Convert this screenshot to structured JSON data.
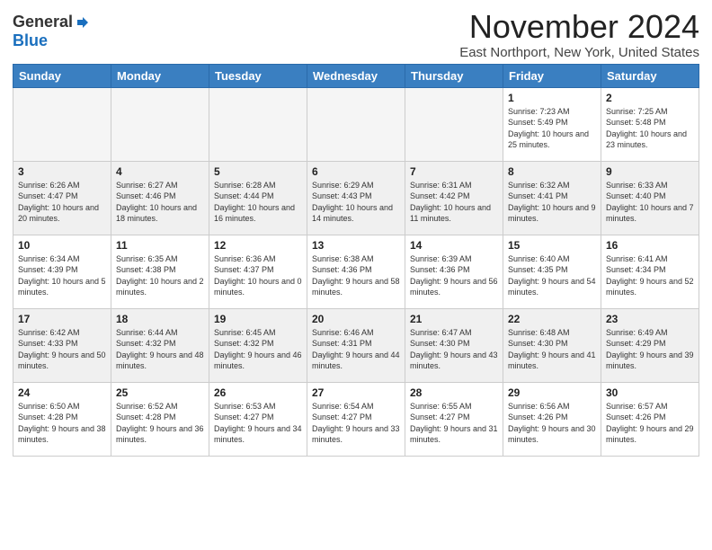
{
  "header": {
    "logo_line1": "General",
    "logo_line2": "Blue",
    "month": "November 2024",
    "location": "East Northport, New York, United States"
  },
  "weekdays": [
    "Sunday",
    "Monday",
    "Tuesday",
    "Wednesday",
    "Thursday",
    "Friday",
    "Saturday"
  ],
  "weeks": [
    [
      {
        "day": "",
        "info": "",
        "empty": true
      },
      {
        "day": "",
        "info": "",
        "empty": true
      },
      {
        "day": "",
        "info": "",
        "empty": true
      },
      {
        "day": "",
        "info": "",
        "empty": true
      },
      {
        "day": "",
        "info": "",
        "empty": true
      },
      {
        "day": "1",
        "info": "Sunrise: 7:23 AM\nSunset: 5:49 PM\nDaylight: 10 hours and 25 minutes."
      },
      {
        "day": "2",
        "info": "Sunrise: 7:25 AM\nSunset: 5:48 PM\nDaylight: 10 hours and 23 minutes."
      }
    ],
    [
      {
        "day": "3",
        "info": "Sunrise: 6:26 AM\nSunset: 4:47 PM\nDaylight: 10 hours and 20 minutes."
      },
      {
        "day": "4",
        "info": "Sunrise: 6:27 AM\nSunset: 4:46 PM\nDaylight: 10 hours and 18 minutes."
      },
      {
        "day": "5",
        "info": "Sunrise: 6:28 AM\nSunset: 4:44 PM\nDaylight: 10 hours and 16 minutes."
      },
      {
        "day": "6",
        "info": "Sunrise: 6:29 AM\nSunset: 4:43 PM\nDaylight: 10 hours and 14 minutes."
      },
      {
        "day": "7",
        "info": "Sunrise: 6:31 AM\nSunset: 4:42 PM\nDaylight: 10 hours and 11 minutes."
      },
      {
        "day": "8",
        "info": "Sunrise: 6:32 AM\nSunset: 4:41 PM\nDaylight: 10 hours and 9 minutes."
      },
      {
        "day": "9",
        "info": "Sunrise: 6:33 AM\nSunset: 4:40 PM\nDaylight: 10 hours and 7 minutes."
      }
    ],
    [
      {
        "day": "10",
        "info": "Sunrise: 6:34 AM\nSunset: 4:39 PM\nDaylight: 10 hours and 5 minutes."
      },
      {
        "day": "11",
        "info": "Sunrise: 6:35 AM\nSunset: 4:38 PM\nDaylight: 10 hours and 2 minutes."
      },
      {
        "day": "12",
        "info": "Sunrise: 6:36 AM\nSunset: 4:37 PM\nDaylight: 10 hours and 0 minutes."
      },
      {
        "day": "13",
        "info": "Sunrise: 6:38 AM\nSunset: 4:36 PM\nDaylight: 9 hours and 58 minutes."
      },
      {
        "day": "14",
        "info": "Sunrise: 6:39 AM\nSunset: 4:36 PM\nDaylight: 9 hours and 56 minutes."
      },
      {
        "day": "15",
        "info": "Sunrise: 6:40 AM\nSunset: 4:35 PM\nDaylight: 9 hours and 54 minutes."
      },
      {
        "day": "16",
        "info": "Sunrise: 6:41 AM\nSunset: 4:34 PM\nDaylight: 9 hours and 52 minutes."
      }
    ],
    [
      {
        "day": "17",
        "info": "Sunrise: 6:42 AM\nSunset: 4:33 PM\nDaylight: 9 hours and 50 minutes."
      },
      {
        "day": "18",
        "info": "Sunrise: 6:44 AM\nSunset: 4:32 PM\nDaylight: 9 hours and 48 minutes."
      },
      {
        "day": "19",
        "info": "Sunrise: 6:45 AM\nSunset: 4:32 PM\nDaylight: 9 hours and 46 minutes."
      },
      {
        "day": "20",
        "info": "Sunrise: 6:46 AM\nSunset: 4:31 PM\nDaylight: 9 hours and 44 minutes."
      },
      {
        "day": "21",
        "info": "Sunrise: 6:47 AM\nSunset: 4:30 PM\nDaylight: 9 hours and 43 minutes."
      },
      {
        "day": "22",
        "info": "Sunrise: 6:48 AM\nSunset: 4:30 PM\nDaylight: 9 hours and 41 minutes."
      },
      {
        "day": "23",
        "info": "Sunrise: 6:49 AM\nSunset: 4:29 PM\nDaylight: 9 hours and 39 minutes."
      }
    ],
    [
      {
        "day": "24",
        "info": "Sunrise: 6:50 AM\nSunset: 4:28 PM\nDaylight: 9 hours and 38 minutes."
      },
      {
        "day": "25",
        "info": "Sunrise: 6:52 AM\nSunset: 4:28 PM\nDaylight: 9 hours and 36 minutes."
      },
      {
        "day": "26",
        "info": "Sunrise: 6:53 AM\nSunset: 4:27 PM\nDaylight: 9 hours and 34 minutes."
      },
      {
        "day": "27",
        "info": "Sunrise: 6:54 AM\nSunset: 4:27 PM\nDaylight: 9 hours and 33 minutes."
      },
      {
        "day": "28",
        "info": "Sunrise: 6:55 AM\nSunset: 4:27 PM\nDaylight: 9 hours and 31 minutes."
      },
      {
        "day": "29",
        "info": "Sunrise: 6:56 AM\nSunset: 4:26 PM\nDaylight: 9 hours and 30 minutes."
      },
      {
        "day": "30",
        "info": "Sunrise: 6:57 AM\nSunset: 4:26 PM\nDaylight: 9 hours and 29 minutes."
      }
    ]
  ]
}
